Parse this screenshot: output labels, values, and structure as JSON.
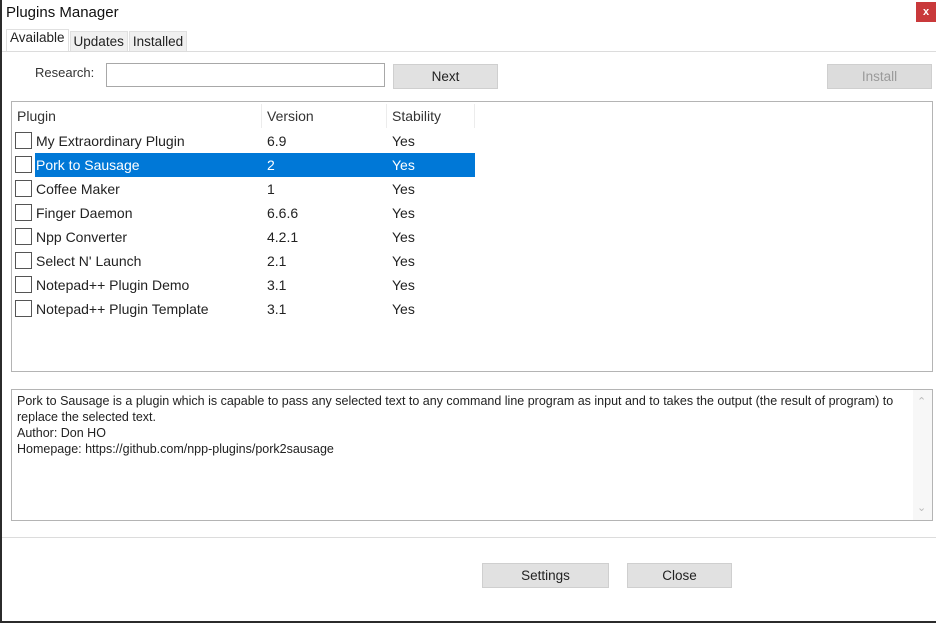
{
  "window": {
    "title": "Plugins Manager",
    "close_label": "x"
  },
  "tabs": [
    {
      "label": "Available",
      "active": true
    },
    {
      "label": "Updates"
    },
    {
      "label": "Installed"
    }
  ],
  "search": {
    "label": "Research:",
    "value": "",
    "next_label": "Next",
    "install_label": "Install"
  },
  "table": {
    "headers": [
      "Plugin",
      "Version",
      "Stability"
    ],
    "rows": [
      {
        "name": "My Extraordinary Plugin",
        "version": "6.9",
        "stability": "Yes",
        "checked": false
      },
      {
        "name": "Pork to Sausage",
        "version": "2",
        "stability": "Yes",
        "checked": false,
        "selected": true
      },
      {
        "name": "Coffee Maker",
        "version": "1",
        "stability": "Yes",
        "checked": false
      },
      {
        "name": "Finger Daemon",
        "version": "6.6.6",
        "stability": "Yes",
        "checked": false
      },
      {
        "name": "Npp Converter",
        "version": "4.2.1",
        "stability": "Yes",
        "checked": false
      },
      {
        "name": "Select N' Launch",
        "version": "2.1",
        "stability": "Yes",
        "checked": false
      },
      {
        "name": "Notepad++ Plugin Demo",
        "version": "3.1",
        "stability": "Yes",
        "checked": false
      },
      {
        "name": "Notepad++ Plugin Template",
        "version": "3.1",
        "stability": "Yes",
        "checked": false
      }
    ]
  },
  "description": {
    "text": "Pork to Sausage is a plugin which is capable to pass any selected text to any command line program as input and to takes the output (the result of program) to replace the selected text.",
    "author": "Author: Don HO",
    "homepage": "Homepage: https://github.com/npp-plugins/pork2sausage"
  },
  "footer": {
    "settings_label": "Settings",
    "close_label": "Close"
  },
  "colors": {
    "selection": "#0078d7",
    "close_button": "#c9393b"
  }
}
